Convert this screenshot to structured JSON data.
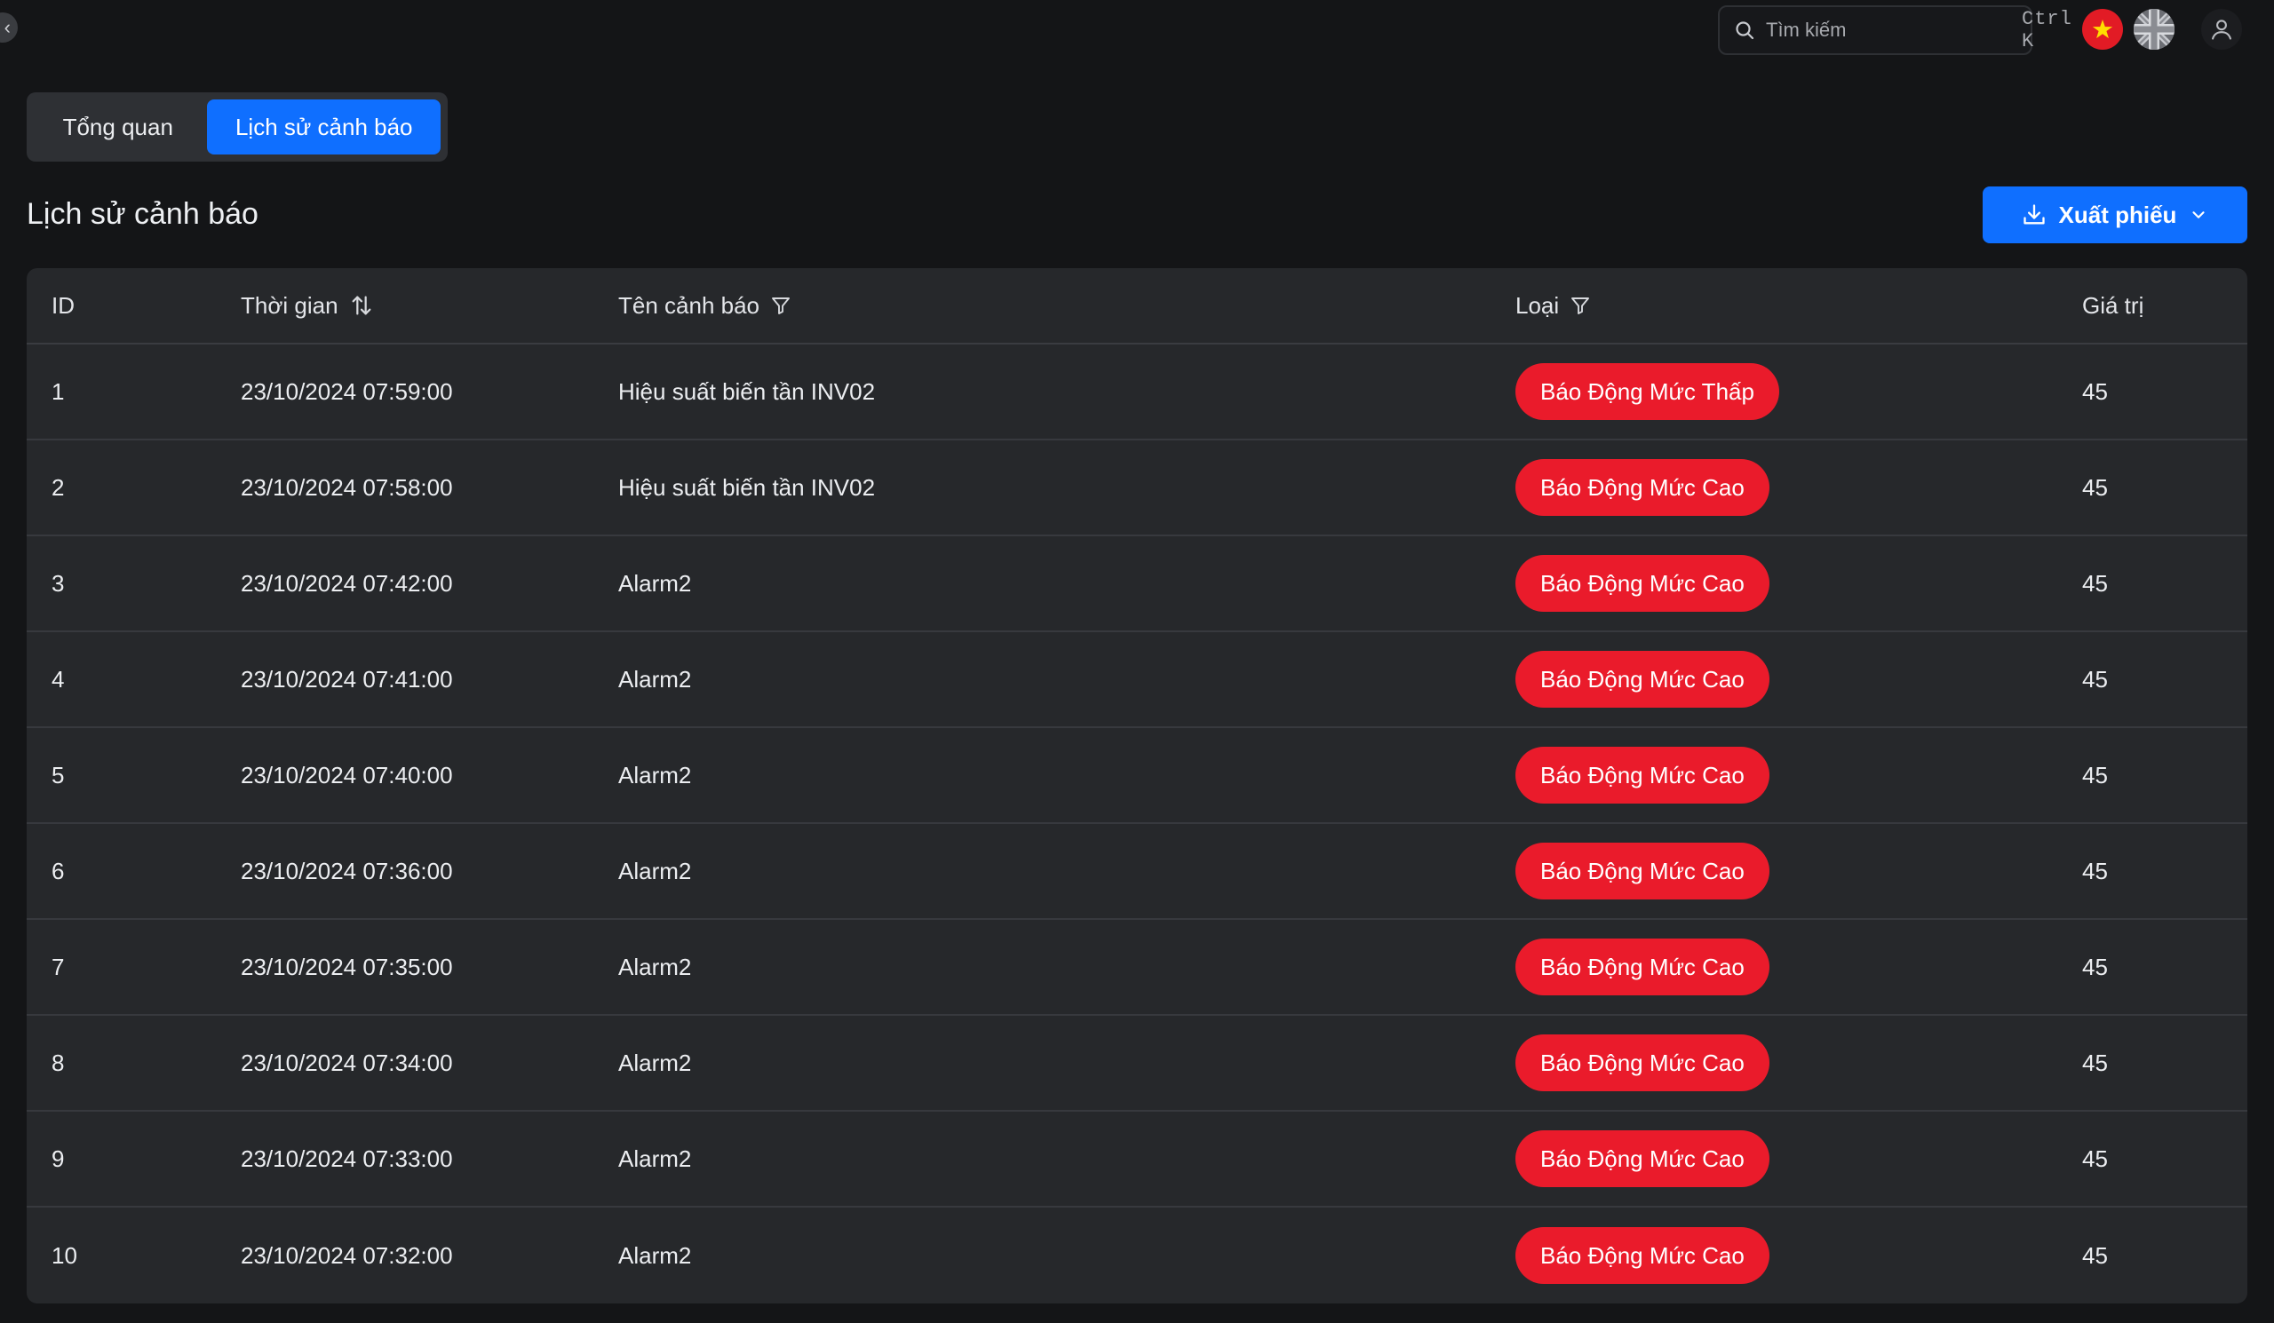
{
  "topbar": {
    "search_placeholder": "Tìm kiếm",
    "search_shortcut": "Ctrl K"
  },
  "tabs": [
    {
      "label": "Tổng quan",
      "active": false
    },
    {
      "label": "Lịch sử cảnh báo",
      "active": true
    }
  ],
  "page": {
    "title": "Lịch sử cảnh báo",
    "export_label": "Xuất phiếu"
  },
  "table": {
    "columns": {
      "id": "ID",
      "time": "Thời gian",
      "name": "Tên cảnh báo",
      "type": "Loại",
      "value": "Giá trị"
    },
    "rows": [
      {
        "id": "1",
        "time": "23/10/2024 07:59:00",
        "name": "Hiệu suất biến tần INV02",
        "type": "Báo Động Mức Thấp",
        "value": "45"
      },
      {
        "id": "2",
        "time": "23/10/2024 07:58:00",
        "name": "Hiệu suất biến tần INV02",
        "type": "Báo Động Mức Cao",
        "value": "45"
      },
      {
        "id": "3",
        "time": "23/10/2024 07:42:00",
        "name": "Alarm2",
        "type": "Báo Động Mức Cao",
        "value": "45"
      },
      {
        "id": "4",
        "time": "23/10/2024 07:41:00",
        "name": "Alarm2",
        "type": "Báo Động Mức Cao",
        "value": "45"
      },
      {
        "id": "5",
        "time": "23/10/2024 07:40:00",
        "name": "Alarm2",
        "type": "Báo Động Mức Cao",
        "value": "45"
      },
      {
        "id": "6",
        "time": "23/10/2024 07:36:00",
        "name": "Alarm2",
        "type": "Báo Động Mức Cao",
        "value": "45"
      },
      {
        "id": "7",
        "time": "23/10/2024 07:35:00",
        "name": "Alarm2",
        "type": "Báo Động Mức Cao",
        "value": "45"
      },
      {
        "id": "8",
        "time": "23/10/2024 07:34:00",
        "name": "Alarm2",
        "type": "Báo Động Mức Cao",
        "value": "45"
      },
      {
        "id": "9",
        "time": "23/10/2024 07:33:00",
        "name": "Alarm2",
        "type": "Báo Động Mức Cao",
        "value": "45"
      },
      {
        "id": "10",
        "time": "23/10/2024 07:32:00",
        "name": "Alarm2",
        "type": "Báo Động Mức Cao",
        "value": "45"
      }
    ]
  },
  "colors": {
    "accent": "#0f6fff",
    "alarm_badge": "#ea1b2b",
    "background": "#141517",
    "table_bg": "#26282b"
  },
  "icons": {
    "search": "search-icon",
    "sort": "sort-icon",
    "filter": "filter-icon",
    "download": "download-icon",
    "chevron": "chevron-down-icon",
    "user": "user-icon"
  }
}
